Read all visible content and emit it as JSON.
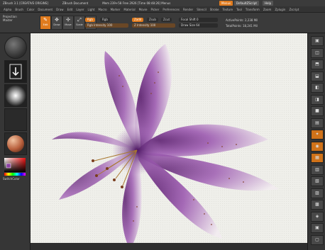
{
  "titlebar": {
    "app": "ZBrush 3.1 [CREATIVE ORIGINS]",
    "doc": "ZBrush Document",
    "stats": "Mem 239+58 Free 2926 [Time 08:48:26] Menus",
    "menus_btn": "Menus",
    "script_btn": "DefaultZScript",
    "help_btn": "Help"
  },
  "menubar": {
    "items": [
      "Alpha",
      "Brush",
      "Color",
      "Document",
      "Draw",
      "Edit",
      "Layer",
      "Light",
      "Macro",
      "Marker",
      "Material",
      "Movie",
      "Picker",
      "Preferences",
      "Render",
      "Stencil",
      "Stroke",
      "Texture",
      "Tool",
      "Transform",
      "Zoom",
      "Zplugin",
      "Zscript"
    ]
  },
  "toolbar": {
    "projection_master": "Projection Master",
    "tools": [
      {
        "label": "Edit",
        "icon": "✎"
      },
      {
        "label": "Draw",
        "icon": "✥"
      },
      {
        "label": "Move",
        "icon": "✣"
      },
      {
        "label": "Scale",
        "icon": "⤢"
      },
      {
        "label": "Rotate",
        "icon": "⟳"
      }
    ],
    "rgb_mode": "Rgb",
    "rgb_mode2": "Rgb",
    "rgb_intensity": "Rgb Intensity 100",
    "rgb_intensity_value": 1.0,
    "zadd": "Zadd",
    "zsub": "Zsub",
    "zcut": "Zcut",
    "z_intensity": "Z Intensity 100",
    "z_intensity_value": 1.0,
    "focal_shift": "Focal Shift 0",
    "draw_size": "Draw Size 64",
    "active_points": "ActivePoints: 2,238 Mil",
    "total_points": "TotalPoints: 18,241 Mil"
  },
  "leftpanel": {
    "switch_color": "SwitchColor"
  },
  "rightpanel": {
    "buttons": [
      "▣",
      "◫",
      "⬒",
      "⬓",
      "◧",
      "◨",
      "■",
      "▤",
      "✦",
      "◉",
      "▦",
      "▥",
      "▧",
      "▨",
      "▩",
      "◈",
      "▣",
      "▢"
    ]
  },
  "colors": {
    "accent": "#e07b1e",
    "petal": "#8a3fa3",
    "canvas": "#efefea"
  }
}
